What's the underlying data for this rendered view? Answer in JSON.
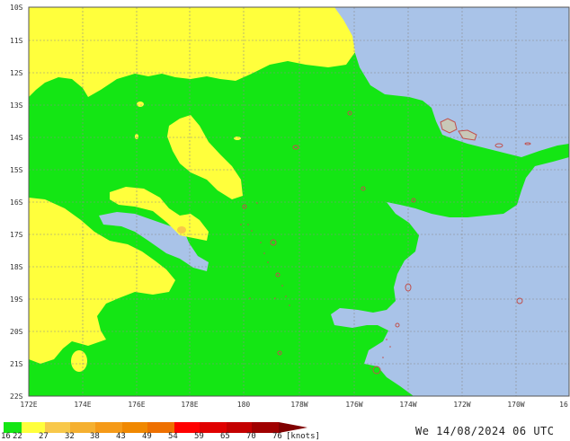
{
  "map": {
    "lat_labels": [
      "10S",
      "11S",
      "12S",
      "13S",
      "14S",
      "15S",
      "16S",
      "17S",
      "18S",
      "19S",
      "20S",
      "21S",
      "22S"
    ],
    "lon_labels": [
      "172E",
      "174E",
      "176E",
      "178E",
      "180",
      "178W",
      "176W",
      "174W",
      "172W",
      "170W",
      "16"
    ],
    "colors": {
      "land": "#a9c3e8",
      "wind_16_22": "#14e614",
      "wind_22_27": "#ffff3c",
      "coast": "#c0504d",
      "grid": "#8a8a8a",
      "island_fill": "#c8c8b8"
    }
  },
  "legend": {
    "colors": [
      "#14e614",
      "#ffff3c",
      "#f8c84a",
      "#f5b030",
      "#f59a18",
      "#f08800",
      "#ee7000",
      "#ff0000",
      "#e00000",
      "#c40000",
      "#a00000",
      "#800000"
    ],
    "labels": [
      "16",
      "22",
      "27",
      "32",
      "38",
      "43",
      "49",
      "54",
      "59",
      "65",
      "70",
      "76"
    ],
    "unit": "[knots]"
  },
  "valid_time": "We 14/08/2024 06 UTC"
}
